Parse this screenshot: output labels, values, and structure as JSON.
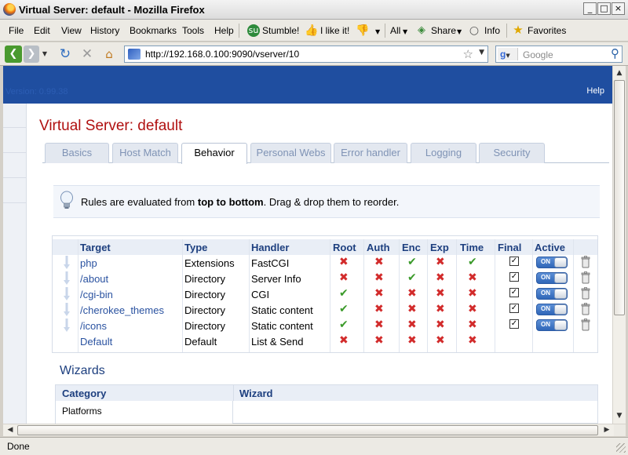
{
  "window": {
    "title": "Virtual Server: default - Mozilla Firefox"
  },
  "menu": {
    "items": [
      "File",
      "Edit",
      "View",
      "History",
      "Bookmarks",
      "Tools",
      "Help"
    ],
    "stumble": "Stumble!",
    "ilike": "I like it!",
    "all": "All",
    "share": "Share",
    "info": "Info",
    "favorites": "Favorites"
  },
  "nav": {
    "url": "http://192.168.0.100:9090/vserver/10",
    "search_placeholder": "Google"
  },
  "app": {
    "version": "Version: 0.99.38",
    "help": "Help",
    "page_title": "Virtual Server: default",
    "tabs": [
      "Basics",
      "Host Match",
      "Behavior",
      "Personal Webs",
      "Error handler",
      "Logging",
      "Security"
    ],
    "active_tab": "Behavior",
    "info_prefix": "Rules are evaluated from ",
    "info_bold": "top to bottom",
    "info_suffix": ". Drag & drop them to reorder."
  },
  "rules": {
    "columns": [
      "Target",
      "Type",
      "Handler",
      "Root",
      "Auth",
      "Enc",
      "Exp",
      "Time",
      "Final",
      "Active"
    ],
    "rows": [
      {
        "target": "php",
        "type": "Extensions",
        "handler": "FastCGI",
        "root": "x",
        "auth": "x",
        "enc": "ok",
        "exp": "x",
        "time": "ok",
        "final": true,
        "active": "ON"
      },
      {
        "target": "/about",
        "type": "Directory",
        "handler": "Server Info",
        "root": "x",
        "auth": "x",
        "enc": "ok",
        "exp": "x",
        "time": "x",
        "final": true,
        "active": "ON"
      },
      {
        "target": "/cgi-bin",
        "type": "Directory",
        "handler": "CGI",
        "root": "ok",
        "auth": "x",
        "enc": "x",
        "exp": "x",
        "time": "x",
        "final": true,
        "active": "ON"
      },
      {
        "target": "/cherokee_themes",
        "type": "Directory",
        "handler": "Static content",
        "root": "ok",
        "auth": "x",
        "enc": "x",
        "exp": "x",
        "time": "x",
        "final": true,
        "active": "ON"
      },
      {
        "target": "/icons",
        "type": "Directory",
        "handler": "Static content",
        "root": "ok",
        "auth": "x",
        "enc": "x",
        "exp": "x",
        "time": "x",
        "final": true,
        "active": "ON"
      },
      {
        "target": "Default",
        "type": "Default",
        "handler": "List & Send",
        "root": "x",
        "auth": "x",
        "enc": "x",
        "exp": "x",
        "time": "x",
        "final": null,
        "active": null
      }
    ]
  },
  "wizards": {
    "title": "Wizards",
    "col_category": "Category",
    "col_wizard": "Wizard",
    "first_category": "Platforms"
  },
  "status": {
    "text": "Done"
  },
  "colors": {
    "app_header": "#1f4ea0",
    "title_red": "#b01010",
    "link_blue": "#2a52a0",
    "cross_red": "#d22b2b",
    "check_green": "#3b9a2a"
  }
}
